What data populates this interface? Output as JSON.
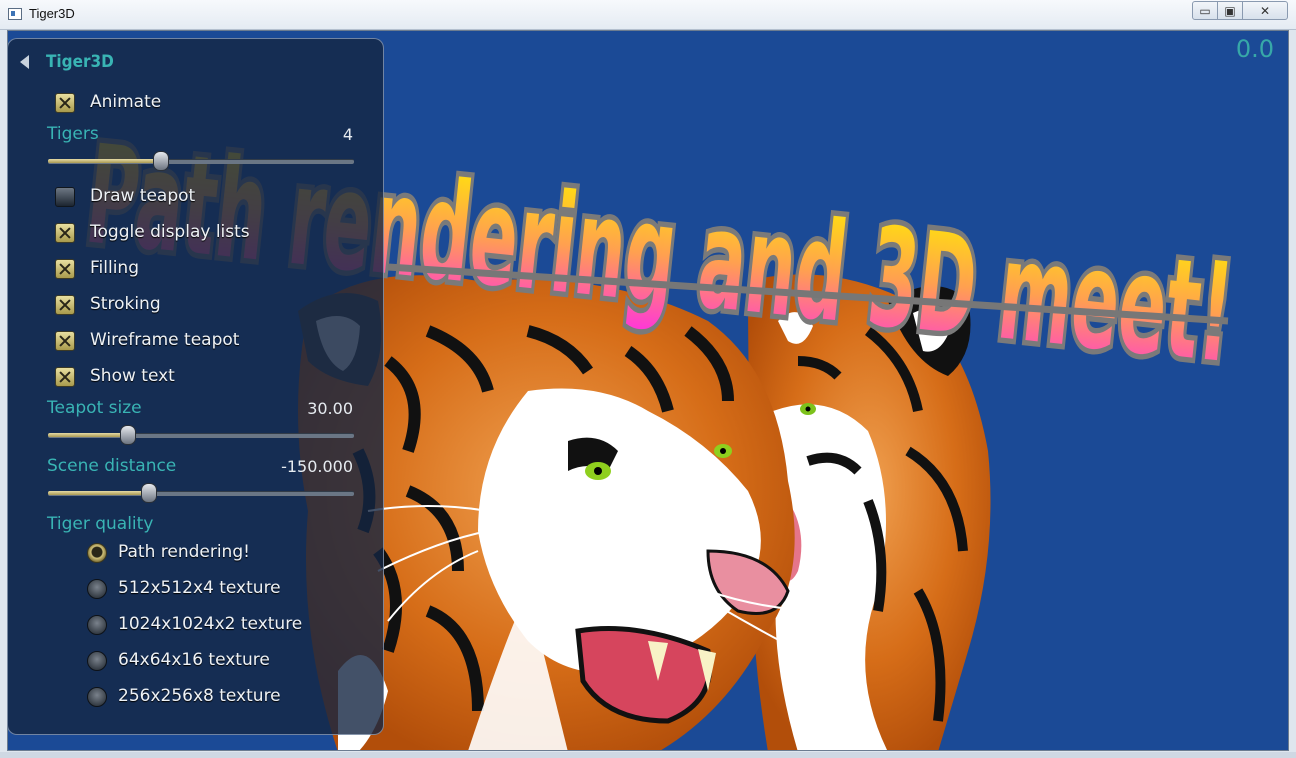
{
  "window": {
    "title": "Tiger3D",
    "buttons": {
      "minimize": "▭",
      "maximize": "▣",
      "close": "✕"
    }
  },
  "viewport": {
    "fps": "0.0",
    "banner_text": "Path rendering and 3D meet!",
    "background": "#1b4a96"
  },
  "panel": {
    "title": "Tiger3D",
    "checkboxes": [
      {
        "label": "Animate",
        "checked": true
      },
      {
        "label": "Draw teapot",
        "checked": false
      },
      {
        "label": "Toggle display lists",
        "checked": true
      },
      {
        "label": "Filling",
        "checked": true
      },
      {
        "label": "Stroking",
        "checked": true
      },
      {
        "label": "Wireframe teapot",
        "checked": true
      },
      {
        "label": "Show text",
        "checked": true
      }
    ],
    "sliders": {
      "tigers": {
        "label": "Tigers",
        "value": "4",
        "fraction": 0.37
      },
      "teapot_size": {
        "label": "Teapot size",
        "value": "30.00",
        "fraction": 0.26
      },
      "scene_distance": {
        "label": "Scene distance",
        "value": "-150.000",
        "fraction": 0.33
      }
    },
    "quality": {
      "label": "Tiger quality",
      "options": [
        {
          "label": "Path rendering!",
          "selected": true
        },
        {
          "label": "512x512x4 texture",
          "selected": false
        },
        {
          "label": "1024x1024x2 texture",
          "selected": false
        },
        {
          "label": "64x64x16 texture",
          "selected": false
        },
        {
          "label": "256x256x8 texture",
          "selected": false
        }
      ]
    }
  },
  "colors": {
    "accent": "#39b4b4",
    "checkbox_gold": "#d6c984",
    "banner_pink": "#ff44cc",
    "banner_yellow": "#ffee00"
  }
}
